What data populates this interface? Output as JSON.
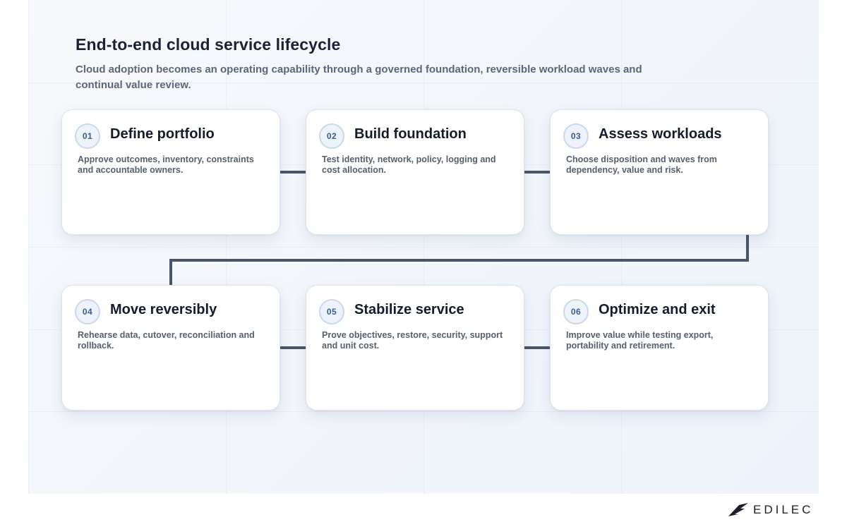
{
  "header": {
    "title": "End-to-end cloud service lifecycle",
    "subtitle": "Cloud adoption becomes an operating capability through a governed foundation, reversible workload waves and continual value review."
  },
  "steps": [
    {
      "number": "01",
      "title": "Define portfolio",
      "description": "Approve outcomes, inventory, constraints and accountable owners."
    },
    {
      "number": "02",
      "title": "Build foundation",
      "description": "Test identity, network, policy, logging and cost allocation."
    },
    {
      "number": "03",
      "title": "Assess workloads",
      "description": "Choose disposition and waves from dependency, value and risk."
    },
    {
      "number": "04",
      "title": "Move reversibly",
      "description": "Rehearse data, cutover, reconciliation and rollback."
    },
    {
      "number": "05",
      "title": "Stabilize service",
      "description": "Prove objectives, restore, security, support and unit cost."
    },
    {
      "number": "06",
      "title": "Optimize and exit",
      "description": "Improve value while testing export, portability and retirement."
    }
  ],
  "brand": {
    "logo_text": "EDILEC",
    "logo_icon": "edilec-logo-icon"
  },
  "colors": {
    "connector": "#4a5568",
    "badge_text": "#3b5b8f",
    "title": "#1a2233"
  }
}
